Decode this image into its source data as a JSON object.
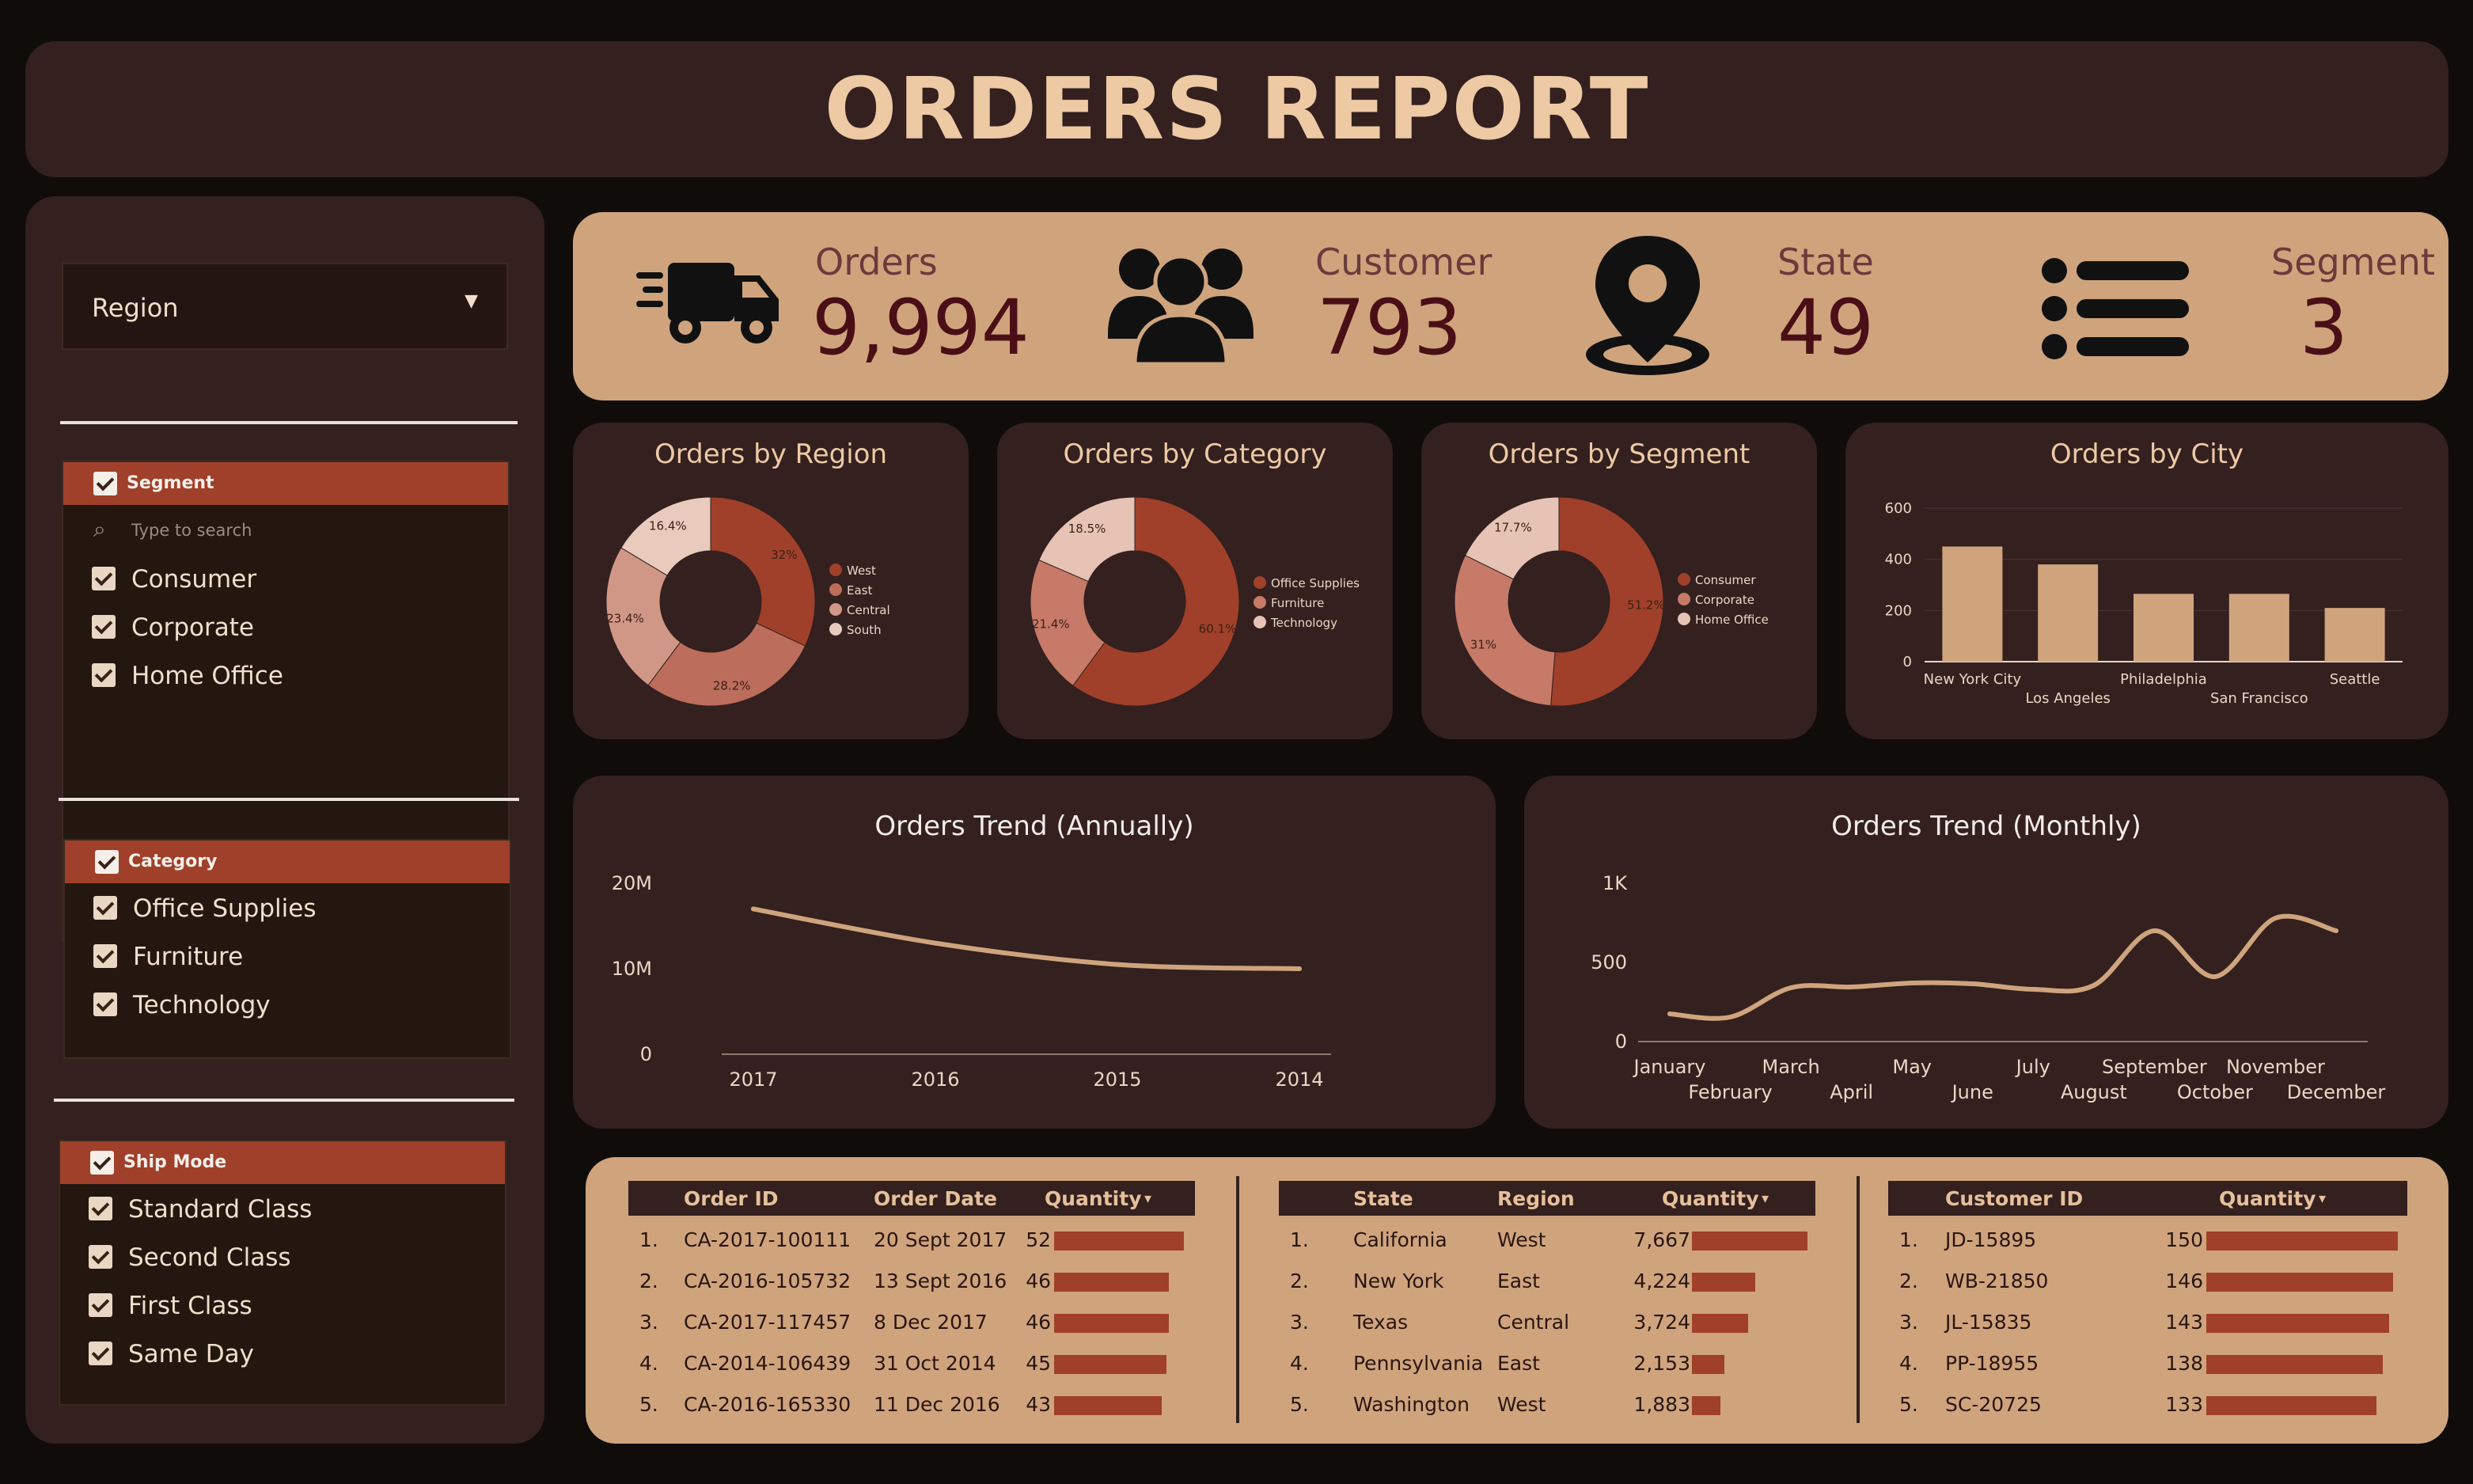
{
  "header": {
    "title": "ORDERS REPORT"
  },
  "sidebar": {
    "region_dropdown": {
      "label": "Region"
    },
    "segment": {
      "title": "Segment",
      "search_placeholder": "Type to search",
      "items": [
        "Consumer",
        "Corporate",
        "Home Office"
      ]
    },
    "category": {
      "title": "Category",
      "items": [
        "Office Supplies",
        "Furniture",
        "Technology"
      ]
    },
    "ship_mode": {
      "title": "Ship Mode",
      "items": [
        "Standard Class",
        "Second Class",
        "First Class",
        "Same Day"
      ]
    }
  },
  "kpis": [
    {
      "label": "Orders",
      "value": "9,994",
      "icon": "truck-icon"
    },
    {
      "label": "Customer",
      "value": "793",
      "icon": "users-icon"
    },
    {
      "label": "State",
      "value": "49",
      "icon": "location-pin-icon"
    },
    {
      "label": "Segment",
      "value": "3",
      "icon": "list-icon"
    }
  ],
  "colors": {
    "accent": "#a0402a",
    "tan": "#cfa47d",
    "card": "#33201f",
    "background": "#100c0a"
  },
  "chart_data": [
    {
      "type": "pie",
      "title": "Orders by Region",
      "labels": [
        "West",
        "East",
        "Central",
        "South"
      ],
      "values": [
        32,
        28.2,
        23.4,
        16.4
      ],
      "value_labels": [
        "32%",
        "28.2%",
        "23.4%",
        "16.4%"
      ],
      "colors": [
        "#a0402a",
        "#bd6d5b",
        "#d19786",
        "#e8cbbd"
      ],
      "legend": "right"
    },
    {
      "type": "pie",
      "title": "Orders by Category",
      "labels": [
        "Office Supplies",
        "Furniture",
        "Technology"
      ],
      "values": [
        60.1,
        21.4,
        18.5
      ],
      "value_labels": [
        "60.1%",
        "21.4%",
        "18.5%"
      ],
      "colors": [
        "#a0402a",
        "#c77a68",
        "#e6c3b4"
      ],
      "legend": "right"
    },
    {
      "type": "pie",
      "title": "Orders by Segment",
      "labels": [
        "Consumer",
        "Corporate",
        "Home Office"
      ],
      "values": [
        51.2,
        31,
        17.7
      ],
      "value_labels": [
        "51.2%",
        "31%",
        "17.7%"
      ],
      "colors": [
        "#a0402a",
        "#c77a68",
        "#e6c3b4"
      ],
      "legend": "right"
    },
    {
      "type": "bar",
      "title": "Orders by City",
      "categories": [
        "New York City",
        "Los Angeles",
        "Philadelphia",
        "San Francisco",
        "Seattle"
      ],
      "values": [
        450,
        380,
        265,
        265,
        210
      ],
      "ylim": [
        0,
        600
      ],
      "yticks": [
        "0",
        "200",
        "400",
        "600"
      ],
      "grid": true
    },
    {
      "type": "line",
      "title": "Orders Trend (Annually)",
      "x": [
        "2017",
        "2016",
        "2015",
        "2014"
      ],
      "values": [
        17000000,
        13000000,
        10500000,
        10000000
      ],
      "ylim": [
        0,
        20000000
      ],
      "yticks": [
        "0",
        "10M",
        "20M"
      ]
    },
    {
      "type": "line",
      "title": "Orders Trend (Monthly)",
      "x": [
        "January",
        "February",
        "March",
        "April",
        "May",
        "June",
        "July",
        "August",
        "September",
        "October",
        "November",
        "December"
      ],
      "values": [
        175,
        155,
        340,
        345,
        370,
        365,
        330,
        355,
        700,
        410,
        780,
        700
      ],
      "ylim": [
        0,
        1000
      ],
      "yticks": [
        "0",
        "500",
        "1K"
      ]
    }
  ],
  "tables": [
    {
      "columns": [
        "Order ID",
        "Order Date",
        "Quantity"
      ],
      "sort_indicator": "▾",
      "max": 52,
      "rows": [
        {
          "rank": "1.",
          "c1": "CA-2017-100111",
          "c2": "20 Sept 2017",
          "qty": 52
        },
        {
          "rank": "2.",
          "c1": "CA-2016-105732",
          "c2": "13 Sept 2016",
          "qty": 46
        },
        {
          "rank": "3.",
          "c1": "CA-2017-117457",
          "c2": "8 Dec 2017",
          "qty": 46
        },
        {
          "rank": "4.",
          "c1": "CA-2014-106439",
          "c2": "31 Oct 2014",
          "qty": 45
        },
        {
          "rank": "5.",
          "c1": "CA-2016-165330",
          "c2": "11 Dec 2016",
          "qty": 43
        }
      ]
    },
    {
      "columns": [
        "State",
        "Region",
        "Quantity"
      ],
      "sort_indicator": "▾",
      "max": 7667,
      "rows": [
        {
          "rank": "1.",
          "c1": "California",
          "c2": "West",
          "qty": "7,667",
          "val": 7667
        },
        {
          "rank": "2.",
          "c1": "New York",
          "c2": "East",
          "qty": "4,224",
          "val": 4224
        },
        {
          "rank": "3.",
          "c1": "Texas",
          "c2": "Central",
          "qty": "3,724",
          "val": 3724
        },
        {
          "rank": "4.",
          "c1": "Pennsylvania",
          "c2": "East",
          "qty": "2,153",
          "val": 2153
        },
        {
          "rank": "5.",
          "c1": "Washington",
          "c2": "West",
          "qty": "1,883",
          "val": 1883
        }
      ]
    },
    {
      "columns": [
        "Customer ID",
        "Quantity"
      ],
      "sort_indicator": "▾",
      "max": 150,
      "rows": [
        {
          "rank": "1.",
          "c1": "JD-15895",
          "qty": 150
        },
        {
          "rank": "2.",
          "c1": "WB-21850",
          "qty": 146
        },
        {
          "rank": "3.",
          "c1": "JL-15835",
          "qty": 143
        },
        {
          "rank": "4.",
          "c1": "PP-18955",
          "qty": 138
        },
        {
          "rank": "5.",
          "c1": "SC-20725",
          "qty": 133
        }
      ]
    }
  ]
}
